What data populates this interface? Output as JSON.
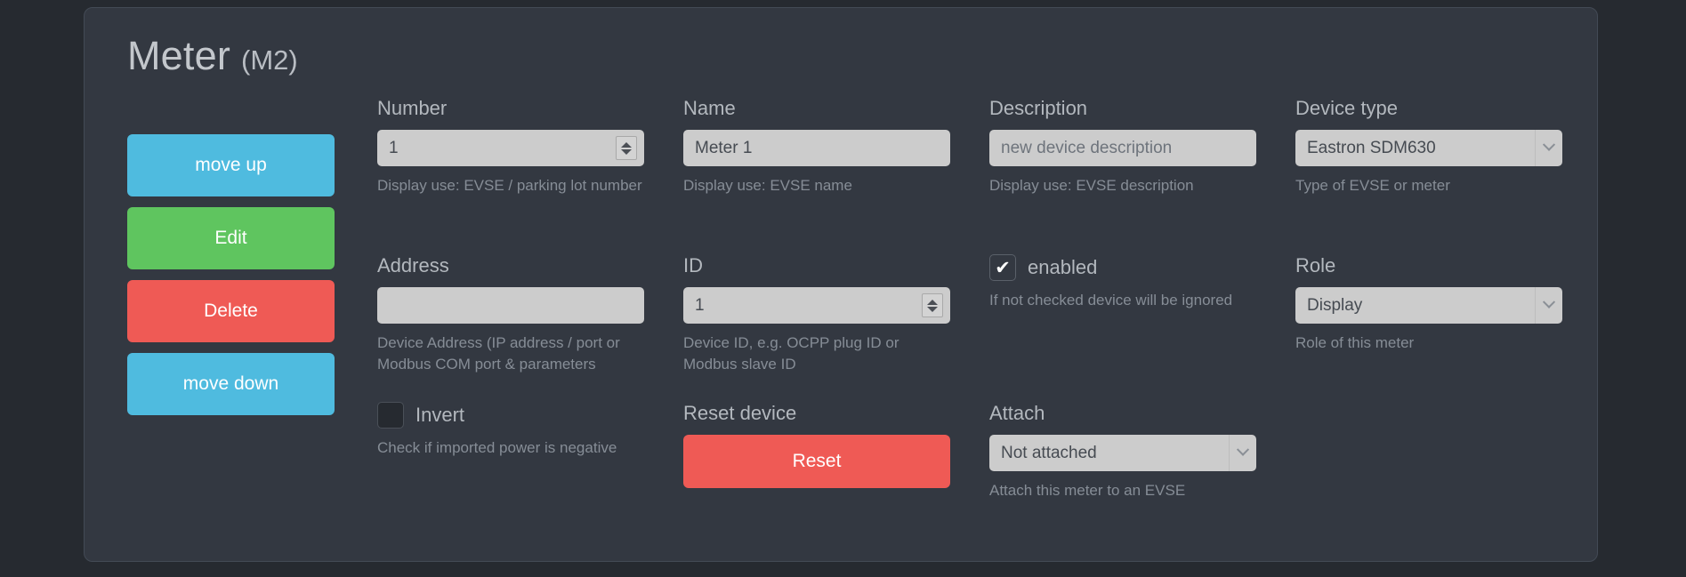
{
  "panel": {
    "title_main": "Meter",
    "title_sub": "(M2)"
  },
  "actions": {
    "move_up": "move up",
    "edit": "Edit",
    "delete": "Delete",
    "move_down": "move down"
  },
  "colors": {
    "page_bg": "#262a30",
    "panel_bg": "#333841",
    "blue": "#4fbbdf",
    "green": "#5fc55f",
    "red": "#ef5a55",
    "input_bg": "#cccccc",
    "label": "#b3b8be",
    "hint": "#868d96"
  },
  "fields": {
    "number": {
      "label": "Number",
      "value": "1",
      "hint": "Display use: EVSE / parking lot number"
    },
    "address": {
      "label": "Address",
      "value": "",
      "placeholder": "",
      "hint": "Device Address (IP address / port or Modbus COM port & parameters"
    },
    "invert": {
      "label": "Invert",
      "checked": false,
      "hint": "Check if imported power is negative"
    },
    "name": {
      "label": "Name",
      "value": "Meter 1",
      "hint": "Display use: EVSE name"
    },
    "id": {
      "label": "ID",
      "value": "1",
      "hint": "Device ID, e.g. OCPP plug ID or Modbus slave ID"
    },
    "reset_device": {
      "label": "Reset device",
      "button_label": "Reset"
    },
    "description": {
      "label": "Description",
      "value": "",
      "placeholder": "new device description",
      "hint": "Display use: EVSE description"
    },
    "enabled": {
      "label": "enabled",
      "checked": true,
      "hint": "If not checked device will be ignored"
    },
    "attach": {
      "label": "Attach",
      "value": "Not attached",
      "hint": "Attach this meter to an EVSE"
    },
    "device_type": {
      "label": "Device type",
      "value": "Eastron SDM630",
      "hint": "Type of EVSE or meter"
    },
    "role": {
      "label": "Role",
      "value": "Display",
      "hint": "Role of this meter"
    }
  }
}
